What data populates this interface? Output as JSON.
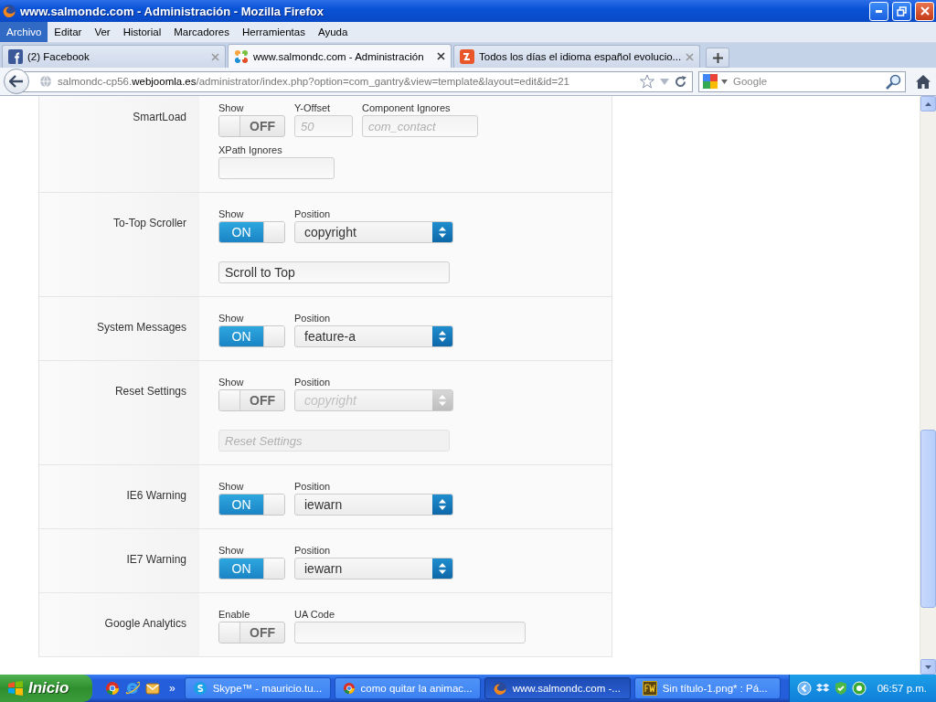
{
  "window": {
    "title": "www.salmondc.com - Administración - Mozilla Firefox"
  },
  "menu": [
    {
      "label": "Archivo",
      "selected": true
    },
    {
      "label": "Editar",
      "selected": false
    },
    {
      "label": "Ver",
      "selected": false
    },
    {
      "label": "Historial",
      "selected": false
    },
    {
      "label": "Marcadores",
      "selected": false
    },
    {
      "label": "Herramientas",
      "selected": false
    },
    {
      "label": "Ayuda",
      "selected": false
    }
  ],
  "tabs": [
    {
      "label": "(2) Facebook",
      "kind": "facebook",
      "selected": false
    },
    {
      "label": "www.salmondc.com - Administración",
      "kind": "joomla",
      "selected": true
    },
    {
      "label": "Todos los días el idioma español evolucio...",
      "kind": "article",
      "selected": false
    }
  ],
  "address_bar": {
    "url": "salmondc-cp56.**webjoomla.es**/administrator/index.php?option=com_gantry&view=template&layout=edit&id=21"
  },
  "search": {
    "placeholder": "Google"
  },
  "form_rows": [
    {
      "label": "SmartLoad",
      "lines": [
        [
          {
            "kind": "toggle",
            "caption": "Show",
            "on": false,
            "text": "OFF"
          },
          {
            "kind": "number",
            "caption": "Y-Offset",
            "placeholder": "50"
          },
          {
            "kind": "text",
            "caption": "Component Ignores",
            "placeholder": "com_contact"
          }
        ],
        [
          {
            "kind": "text",
            "caption": "XPath Ignores"
          }
        ]
      ]
    },
    {
      "label": "To-Top Scroller",
      "lines": [
        [
          {
            "kind": "toggle",
            "caption": "Show",
            "on": true,
            "text": "ON"
          },
          {
            "kind": "select",
            "caption": "Position",
            "value": "copyright",
            "disabled": false
          }
        ],
        [
          {
            "kind": "wide-text",
            "value": "Scroll to Top",
            "disabled": false
          }
        ]
      ]
    },
    {
      "label": "System Messages",
      "lines": [
        [
          {
            "kind": "toggle",
            "caption": "Show",
            "on": true,
            "text": "ON"
          },
          {
            "kind": "select",
            "caption": "Position",
            "value": "feature-a",
            "disabled": false
          }
        ]
      ]
    },
    {
      "label": "Reset Settings",
      "lines": [
        [
          {
            "kind": "toggle",
            "caption": "Show",
            "on": false,
            "text": "OFF"
          },
          {
            "kind": "select",
            "caption": "Position",
            "value": "copyright",
            "disabled": true
          }
        ],
        [
          {
            "kind": "wide-text",
            "placeholder": "Reset Settings",
            "disabled": true
          }
        ]
      ]
    },
    {
      "label": "IE6 Warning",
      "lines": [
        [
          {
            "kind": "toggle",
            "caption": "Show",
            "on": true,
            "text": "ON"
          },
          {
            "kind": "select",
            "caption": "Position",
            "value": "iewarn",
            "disabled": false
          }
        ]
      ]
    },
    {
      "label": "IE7 Warning",
      "lines": [
        [
          {
            "kind": "toggle",
            "caption": "Show",
            "on": true,
            "text": "ON"
          },
          {
            "kind": "select",
            "caption": "Position",
            "value": "iewarn",
            "disabled": false
          }
        ]
      ]
    },
    {
      "label": "Google Analytics",
      "lines": [
        [
          {
            "kind": "toggle",
            "caption": "Enable",
            "on": false,
            "text": "OFF"
          },
          {
            "kind": "wide-text",
            "caption": "UA Code"
          }
        ]
      ]
    }
  ],
  "taskbar": {
    "start": "Inicio",
    "overflow": "»",
    "tasks": [
      {
        "label": "Skype™ - mauricio.tu...",
        "kind": "skype",
        "selected": false
      },
      {
        "label": "como quitar la animac...",
        "kind": "chrome",
        "selected": false
      },
      {
        "label": "www.salmondc.com -...",
        "kind": "firefox",
        "selected": true
      },
      {
        "label": "Sin título-1.png* : Pá...",
        "kind": "fireworks",
        "selected": false
      }
    ],
    "clock": "06:57 p.m."
  }
}
